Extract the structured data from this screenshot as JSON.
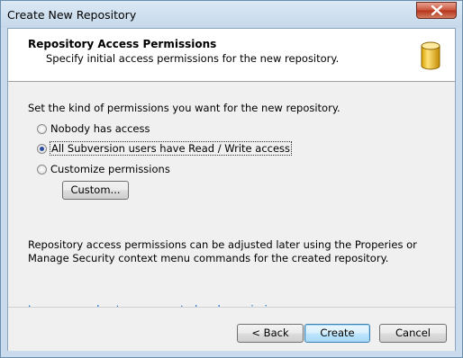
{
  "window": {
    "title": "Create New Repository"
  },
  "header": {
    "title": "Repository Access Permissions",
    "subtitle": "Specify initial access permissions for the new repository.",
    "icon": "database-icon"
  },
  "body": {
    "instruction": "Set the kind of permissions you want for the new repository.",
    "options": [
      {
        "label": "Nobody has access",
        "selected": false
      },
      {
        "label": "All Subversion users have Read / Write access",
        "selected": true
      },
      {
        "label": "Customize permissions",
        "selected": false
      }
    ],
    "custom_button": "Custom...",
    "info": "Repository access permissions can be adjusted later using the Properies or Manage Security context menu commands for the created repository.",
    "link": "Learn more about access control and permissions"
  },
  "footer": {
    "back": "< Back",
    "create": "Create",
    "cancel": "Cancel"
  },
  "colors": {
    "link": "#0066cc",
    "accent": "#3c7fb1"
  }
}
